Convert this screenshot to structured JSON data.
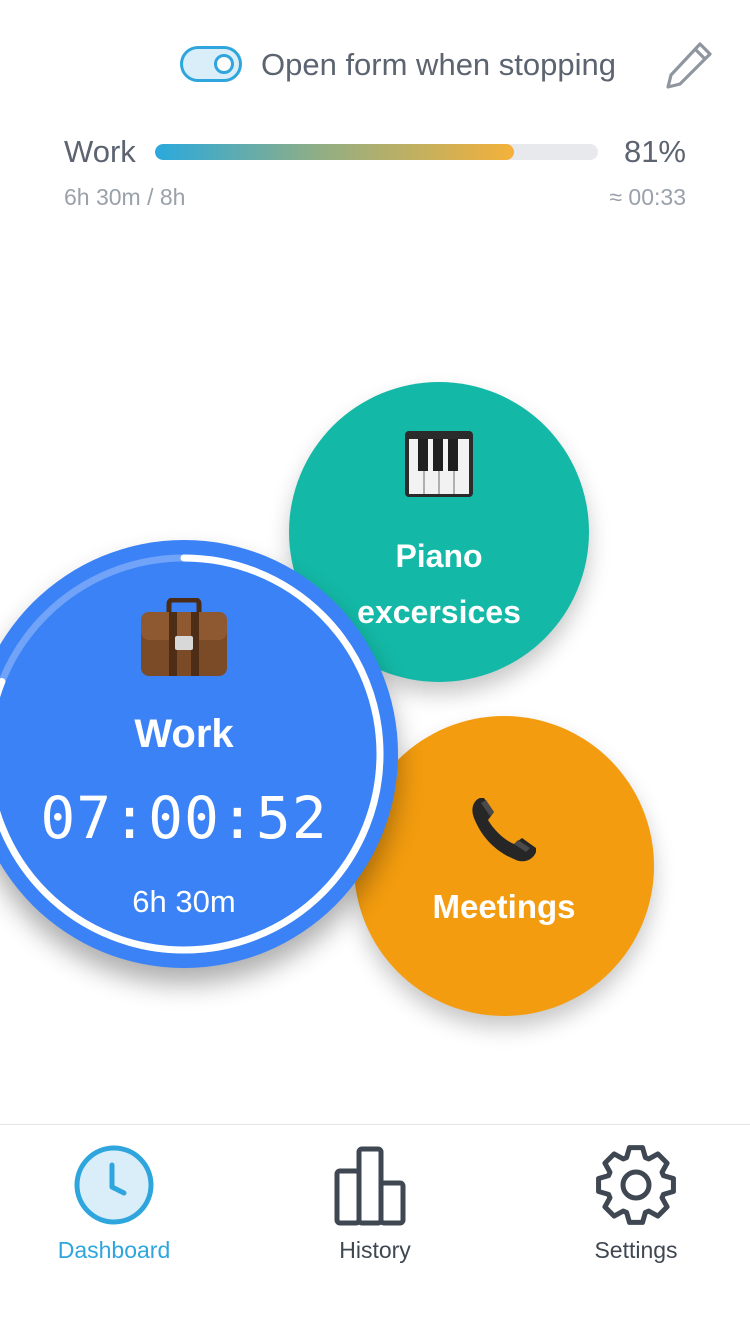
{
  "header": {
    "toggle_label": "Open form when stopping",
    "toggle_on": true
  },
  "progress": {
    "name": "Work",
    "percent_label": "81%",
    "fraction": 0.81,
    "tracked": "6h 30m / 8h",
    "remaining": "≈ 00:33"
  },
  "activities": [
    {
      "name": "Work",
      "emoji": "💼",
      "timer": "07:00:52",
      "duration": "6h 30m",
      "color": "#3b82f6",
      "ring_fraction": 0.81,
      "active": true
    },
    {
      "name_line1": "Piano",
      "name_line2": "excersices",
      "emoji": "🎹",
      "color": "#14b8a6"
    },
    {
      "name": "Meetings",
      "emoji": "📞",
      "color": "#f39c0f"
    }
  ],
  "nav": {
    "items": [
      {
        "label": "Dashboard",
        "icon": "clock-icon",
        "active": true
      },
      {
        "label": "History",
        "icon": "bar-chart-icon",
        "active": false
      },
      {
        "label": "Settings",
        "icon": "gear-icon",
        "active": false
      }
    ]
  },
  "colors": {
    "accent": "#2ea6dd",
    "text": "#5b6470",
    "muted": "#9aa1aa"
  }
}
